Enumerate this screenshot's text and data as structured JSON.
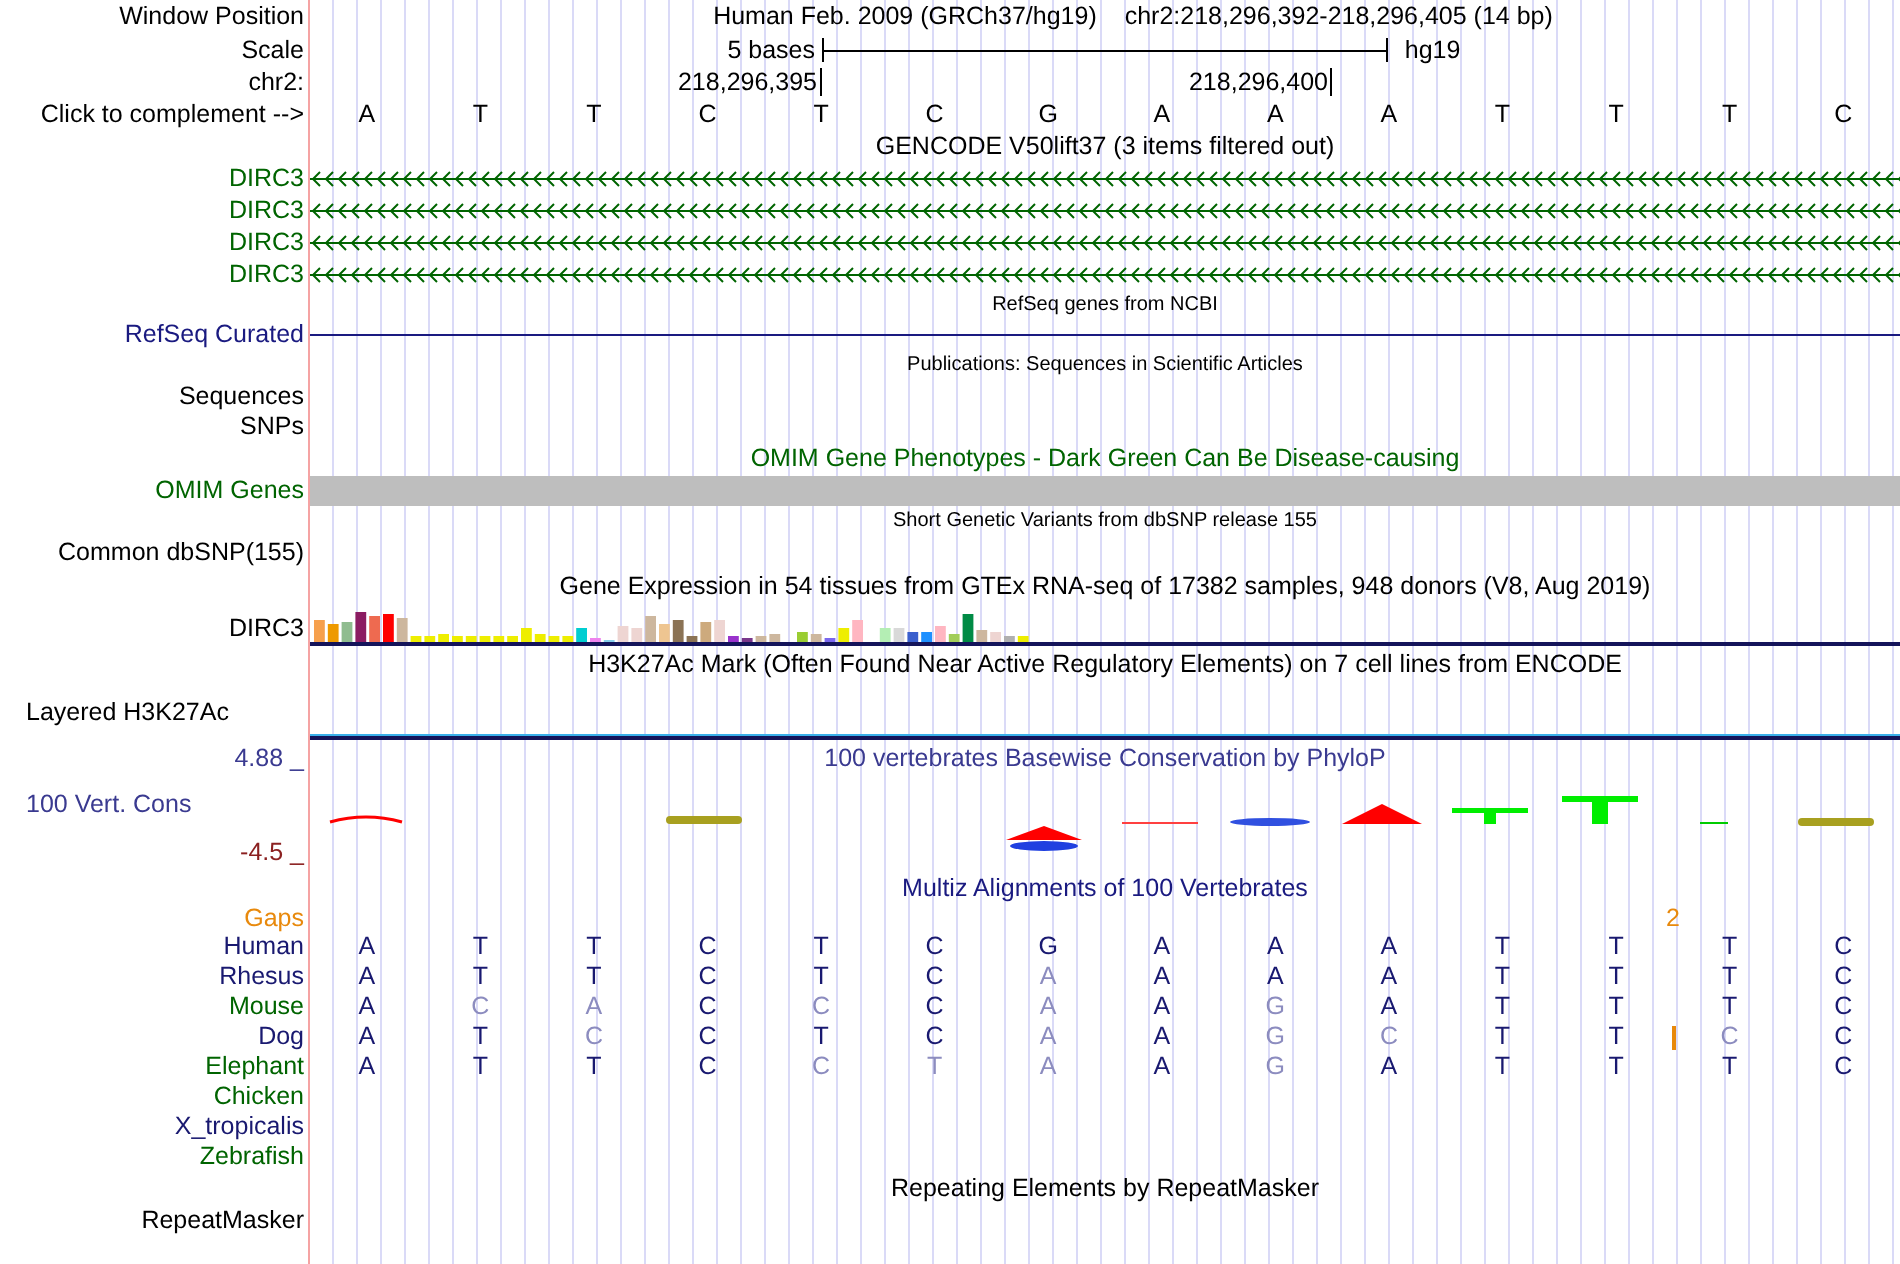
{
  "header": {
    "label": "Window Position",
    "assembly": "Human Feb. 2009 (GRCh37/hg19)",
    "position": "chr2:218,296,392-218,296,405 (14 bp)"
  },
  "scale": {
    "label": "Scale",
    "span": "5 bases",
    "assembly": "hg19"
  },
  "coordinates": {
    "label": "chr2:",
    "ticks": [
      "218,296,395",
      "218,296,400"
    ]
  },
  "complement": {
    "label": "Click to complement -->",
    "bases": [
      "A",
      "T",
      "T",
      "C",
      "T",
      "C",
      "G",
      "A",
      "A",
      "A",
      "T",
      "T",
      "T",
      "C"
    ]
  },
  "gencode": {
    "title": "GENCODE V50lift37 (3 items filtered out)",
    "genes": [
      "DIRC3",
      "DIRC3",
      "DIRC3",
      "DIRC3"
    ]
  },
  "refseq": {
    "title": "RefSeq genes from NCBI",
    "label": "RefSeq Curated"
  },
  "publications": {
    "title": "Publications: Sequences in Scientific Articles",
    "labels": [
      "Sequences",
      "SNPs"
    ]
  },
  "omim": {
    "title": "OMIM Gene Phenotypes - Dark Green Can Be Disease-causing",
    "label": "OMIM Genes"
  },
  "dbsnp": {
    "title": "Short Genetic Variants from dbSNP release 155",
    "label": "Common dbSNP(155)"
  },
  "gtex": {
    "title": "Gene Expression in 54 tissues from GTEx RNA-seq of 17382 samples, 948 donors (V8, Aug 2019)",
    "label": "DIRC3"
  },
  "h3k27ac": {
    "title": "H3K27Ac Mark (Often Found Near Active Regulatory Elements) on 7 cell lines from ENCODE",
    "label": "Layered H3K27Ac"
  },
  "conservation": {
    "title": "100 vertebrates Basewise Conservation by PhyloP",
    "label": "100 Vert. Cons",
    "max": "4.88 _",
    "min": "-4.5 _"
  },
  "multiz": {
    "title": "Multiz Alignments of 100 Vertebrates",
    "gaps": {
      "label": "Gaps",
      "mark": "2"
    },
    "species": [
      {
        "name": "Human",
        "color": "#191970",
        "insertion": false,
        "bases": [
          {
            "text": "A",
            "faded": false
          },
          {
            "text": "T",
            "faded": false
          },
          {
            "text": "T",
            "faded": false
          },
          {
            "text": "C",
            "faded": false
          },
          {
            "text": "T",
            "faded": false
          },
          {
            "text": "C",
            "faded": false
          },
          {
            "text": "G",
            "faded": false
          },
          {
            "text": "A",
            "faded": false
          },
          {
            "text": "A",
            "faded": false
          },
          {
            "text": "A",
            "faded": false
          },
          {
            "text": "T",
            "faded": false
          },
          {
            "text": "T",
            "faded": false
          },
          {
            "text": "T",
            "faded": false
          },
          {
            "text": "C",
            "faded": false
          }
        ]
      },
      {
        "name": "Rhesus",
        "color": "#191970",
        "insertion": false,
        "bases": [
          {
            "text": "A",
            "faded": false
          },
          {
            "text": "T",
            "faded": false
          },
          {
            "text": "T",
            "faded": false
          },
          {
            "text": "C",
            "faded": false
          },
          {
            "text": "T",
            "faded": false
          },
          {
            "text": "C",
            "faded": false
          },
          {
            "text": "A",
            "faded": true
          },
          {
            "text": "A",
            "faded": false
          },
          {
            "text": "A",
            "faded": false
          },
          {
            "text": "A",
            "faded": false
          },
          {
            "text": "T",
            "faded": false
          },
          {
            "text": "T",
            "faded": false
          },
          {
            "text": "T",
            "faded": false
          },
          {
            "text": "C",
            "faded": false
          }
        ]
      },
      {
        "name": "Mouse",
        "color": "#006400",
        "insertion": false,
        "bases": [
          {
            "text": "A",
            "faded": false
          },
          {
            "text": "C",
            "faded": true
          },
          {
            "text": "A",
            "faded": true
          },
          {
            "text": "C",
            "faded": false
          },
          {
            "text": "C",
            "faded": true
          },
          {
            "text": "C",
            "faded": false
          },
          {
            "text": "A",
            "faded": true
          },
          {
            "text": "A",
            "faded": false
          },
          {
            "text": "G",
            "faded": true
          },
          {
            "text": "A",
            "faded": false
          },
          {
            "text": "T",
            "faded": false
          },
          {
            "text": "T",
            "faded": false
          },
          {
            "text": "T",
            "faded": false
          },
          {
            "text": "C",
            "faded": false
          }
        ]
      },
      {
        "name": "Dog",
        "color": "#191970",
        "insertion": true,
        "bases": [
          {
            "text": "A",
            "faded": false
          },
          {
            "text": "T",
            "faded": false
          },
          {
            "text": "C",
            "faded": true
          },
          {
            "text": "C",
            "faded": false
          },
          {
            "text": "T",
            "faded": false
          },
          {
            "text": "C",
            "faded": false
          },
          {
            "text": "A",
            "faded": true
          },
          {
            "text": "A",
            "faded": false
          },
          {
            "text": "G",
            "faded": true
          },
          {
            "text": "C",
            "faded": true
          },
          {
            "text": "T",
            "faded": false
          },
          {
            "text": "T",
            "faded": false
          },
          {
            "text": "C",
            "faded": true
          },
          {
            "text": "C",
            "faded": false
          }
        ]
      },
      {
        "name": "Elephant",
        "color": "#006400",
        "insertion": false,
        "bases": [
          {
            "text": "A",
            "faded": false
          },
          {
            "text": "T",
            "faded": false
          },
          {
            "text": "T",
            "faded": false
          },
          {
            "text": "C",
            "faded": false
          },
          {
            "text": "C",
            "faded": true
          },
          {
            "text": "T",
            "faded": true
          },
          {
            "text": "A",
            "faded": true
          },
          {
            "text": "A",
            "faded": false
          },
          {
            "text": "G",
            "faded": true
          },
          {
            "text": "A",
            "faded": false
          },
          {
            "text": "T",
            "faded": false
          },
          {
            "text": "T",
            "faded": false
          },
          {
            "text": "T",
            "faded": false
          },
          {
            "text": "C",
            "faded": false
          }
        ]
      },
      {
        "name": "Chicken",
        "color": "#006400",
        "insertion": false
      },
      {
        "name": "X_tropicalis",
        "color": "#191970",
        "insertion": false
      },
      {
        "name": "Zebrafish",
        "color": "#006400",
        "insertion": false
      }
    ]
  },
  "repeatmasker": {
    "title": "Repeating Elements by RepeatMasker",
    "label": "RepeatMasker"
  }
}
